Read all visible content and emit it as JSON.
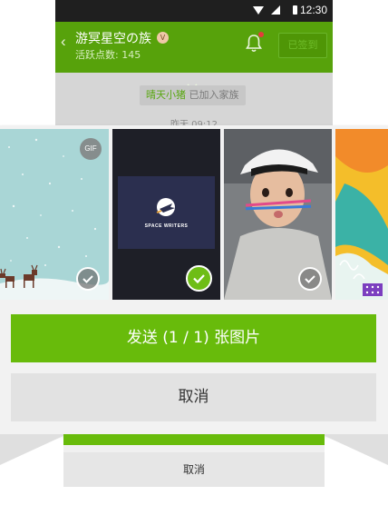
{
  "status_bar": {
    "time": "12:30"
  },
  "header": {
    "back_glyph": "‹",
    "title": "游冥星空の族",
    "level_badge": "V",
    "subtitle": "活跃点数: 145",
    "signed_button": "已签到"
  },
  "chat": {
    "join_user": "晴天小猪",
    "join_text": " 已加入家族",
    "time_divider": "昨天 09:12"
  },
  "picker": {
    "photos": [
      {
        "name": "snowy-deer-gif",
        "badge": "GIF",
        "selected": false
      },
      {
        "name": "space-writers",
        "caption": "SPACE WRITERS",
        "selected": true
      },
      {
        "name": "boy-with-pens",
        "selected": false
      },
      {
        "name": "colorful-illustration",
        "selected": false
      }
    ],
    "send_label": "发送 (1 / 1) 张图片",
    "cancel_label": "取消"
  },
  "reflection": {
    "cancel_label": "取消"
  },
  "colors": {
    "accent_green": "#68bb0b",
    "header_green": "#57a20b",
    "notification_red": "#e53b3b"
  }
}
